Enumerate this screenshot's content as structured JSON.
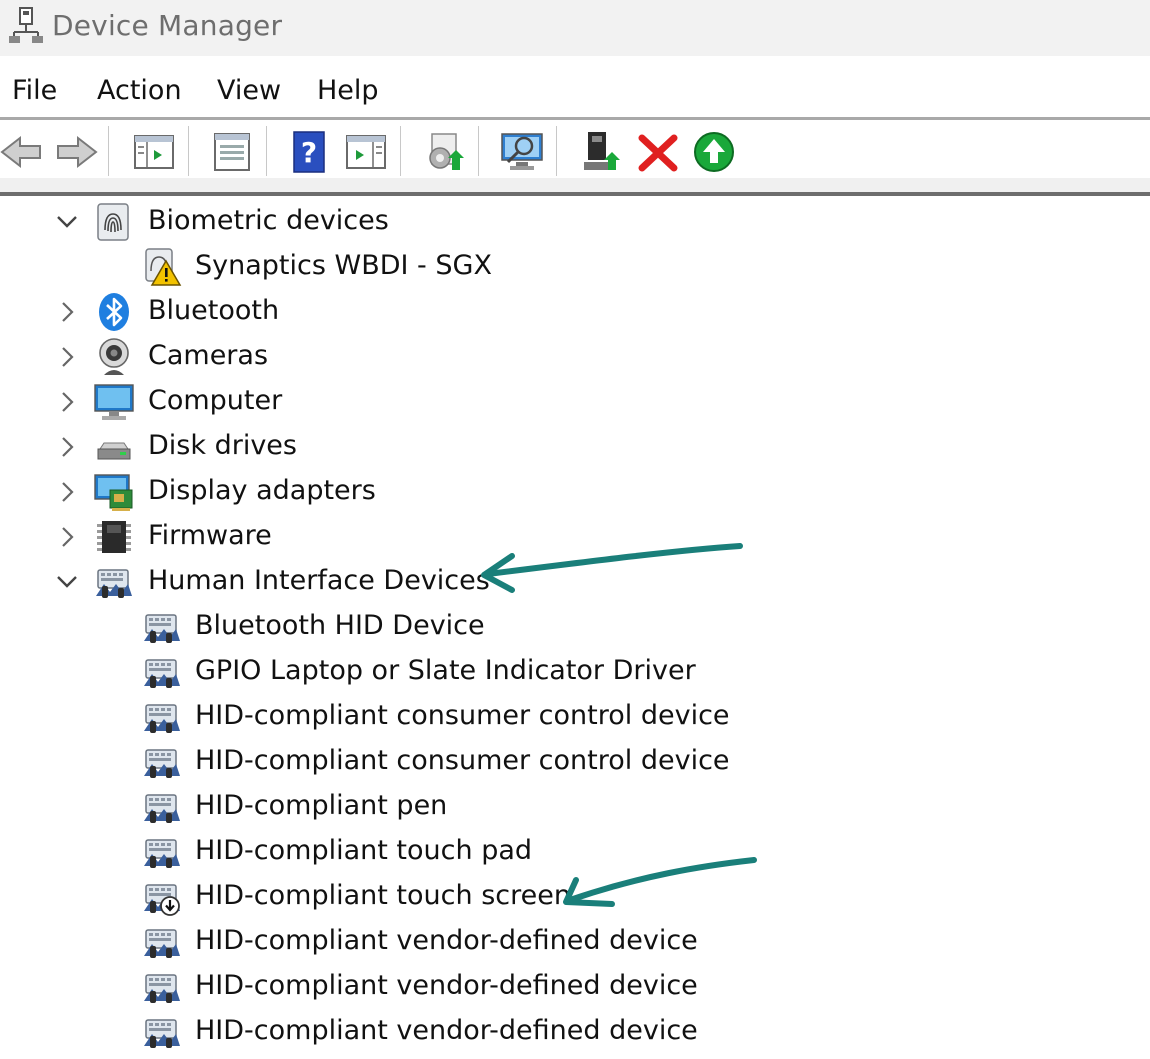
{
  "window": {
    "title": "Device Manager"
  },
  "menu": [
    "File",
    "Action",
    "View",
    "Help"
  ],
  "toolbar": {
    "buttons": [
      "back-icon",
      "forward-icon",
      "show-hide-console-tree-icon",
      "properties-icon",
      "help-icon",
      "action-pane-icon",
      "update-driver-icon",
      "scan-hardware-icon",
      "enable-device-icon",
      "uninstall-device-icon",
      "rollback-driver-icon"
    ]
  },
  "tree": {
    "biometric": {
      "label": "Biometric devices",
      "expanded": true,
      "children": [
        "Synaptics WBDI - SGX"
      ]
    },
    "bluetooth": {
      "label": "Bluetooth",
      "expanded": false
    },
    "cameras": {
      "label": "Cameras",
      "expanded": false
    },
    "computer": {
      "label": "Computer",
      "expanded": false
    },
    "disk": {
      "label": "Disk drives",
      "expanded": false
    },
    "display": {
      "label": "Display adapters",
      "expanded": false
    },
    "firmware": {
      "label": "Firmware",
      "expanded": false
    },
    "hid": {
      "label": "Human Interface Devices",
      "expanded": true,
      "children": [
        "Bluetooth HID Device",
        "GPIO Laptop or Slate Indicator Driver",
        "HID-compliant consumer control device",
        "HID-compliant consumer control device",
        "HID-compliant pen",
        "HID-compliant touch pad",
        "HID-compliant touch screen",
        "HID-compliant vendor-defined device",
        "HID-compliant vendor-defined device",
        "HID-compliant vendor-defined device"
      ]
    }
  },
  "colors": {
    "annotation_arrow": "#1a7f7a",
    "warning": "#f2c200",
    "uninstall_red": "#e02020",
    "rollback_green": "#1aa83a"
  }
}
